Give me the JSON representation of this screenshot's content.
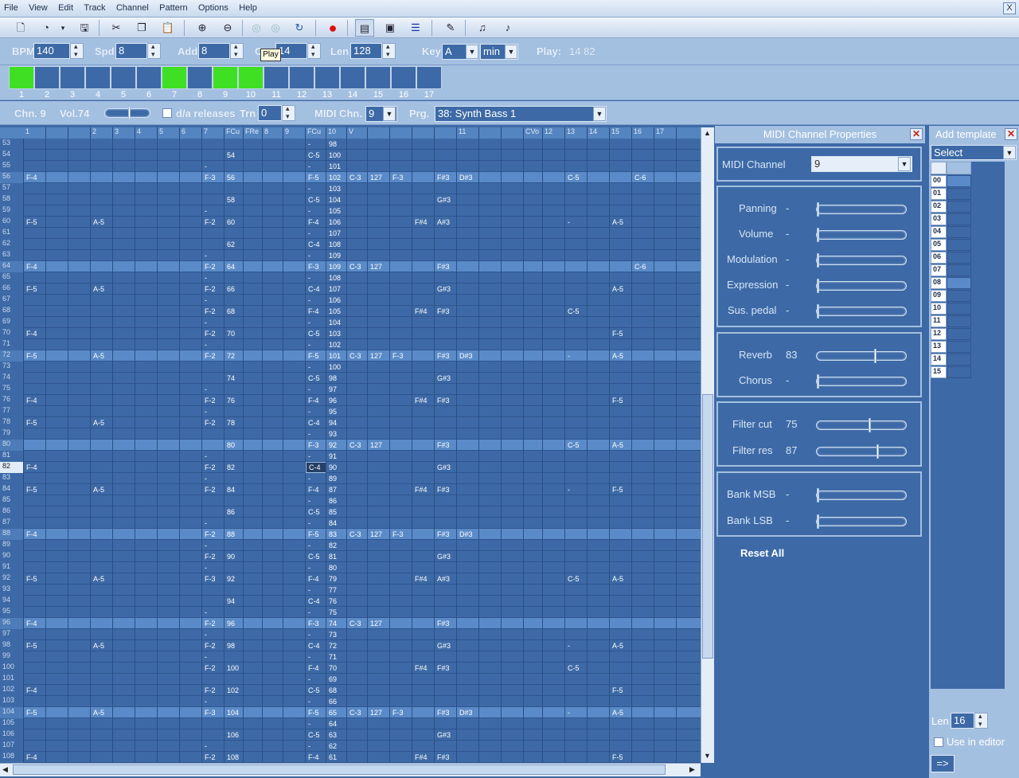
{
  "menu": [
    "File",
    "View",
    "Edit",
    "Track",
    "Channel",
    "Pattern",
    "Options",
    "Help"
  ],
  "menu_close": "X",
  "tooltip": "Play",
  "controls": {
    "bpm_label": "BPM",
    "bpm": "140",
    "spd_label": "Spd",
    "spd": "8",
    "add_label": "Add",
    "add": "8",
    "oct_label": "O",
    "oct": "14",
    "len_label": "Len",
    "len": "128",
    "key_label": "Key",
    "key": "A",
    "mode": "min",
    "play_label": "Play:",
    "play_value": "14 82"
  },
  "patterns": {
    "numbers": [
      "1",
      "2",
      "3",
      "4",
      "5",
      "6",
      "7",
      "8",
      "9",
      "10",
      "11",
      "12",
      "13",
      "14",
      "15",
      "16",
      "17"
    ],
    "active": [
      true,
      false,
      false,
      false,
      false,
      false,
      true,
      false,
      true,
      true,
      false,
      false,
      false,
      false,
      false,
      false,
      false
    ]
  },
  "channel": {
    "chn": "Chn. 9",
    "vol": "Vol.74",
    "da_releases": "d/a releases",
    "trn_label": "Trn",
    "trn": "0",
    "midi_chn_label": "MIDI Chn.",
    "midi_chn": "9",
    "prg_label": "Prg.",
    "prg": "38: Synth Bass 1"
  },
  "grid_headers": [
    "1",
    "",
    "",
    "2",
    "3",
    "4",
    "5",
    "6",
    "7",
    "FCu",
    "FRe",
    "8",
    "9",
    "FCu",
    "10",
    "V",
    "",
    "",
    "",
    "",
    "11",
    "",
    "",
    "CVo",
    "12",
    "13",
    "14",
    "15",
    "16",
    "17"
  ],
  "rows": [
    {
      "n": "53",
      "c": {
        "13": "-",
        "14": "98"
      }
    },
    {
      "n": "54",
      "c": {
        "9": "54",
        "13": "C-5",
        "14": "100"
      }
    },
    {
      "n": "55",
      "c": {
        "8": "-",
        "13": "-",
        "14": "101"
      }
    },
    {
      "n": "56",
      "c": {
        "0": "F-4",
        "8": "F-3",
        "9": "56",
        "13": "F-5",
        "14": "102",
        "15": "C-3",
        "16": "127",
        "17": "F-3",
        "19": "F#3",
        "20": "D#3",
        "25": "C-5",
        "28": "C-6"
      }
    },
    {
      "n": "57",
      "c": {
        "13": "-",
        "14": "103"
      }
    },
    {
      "n": "58",
      "c": {
        "9": "58",
        "13": "C-5",
        "14": "104",
        "19": "G#3"
      }
    },
    {
      "n": "59",
      "c": {
        "8": "-",
        "13": "-",
        "14": "105"
      }
    },
    {
      "n": "60",
      "c": {
        "0": "F-5",
        "3": "A-5",
        "8": "F-2",
        "9": "60",
        "13": "F-4",
        "14": "106",
        "18": "F#4",
        "19": "A#3",
        "25": "-",
        "27": "A-5"
      }
    },
    {
      "n": "61",
      "c": {
        "13": "-",
        "14": "107"
      }
    },
    {
      "n": "62",
      "c": {
        "9": "62",
        "13": "C-4",
        "14": "108"
      }
    },
    {
      "n": "63",
      "c": {
        "8": "-",
        "13": "-",
        "14": "109"
      }
    },
    {
      "n": "64",
      "c": {
        "0": "F-4",
        "8": "F-2",
        "9": "64",
        "13": "F-3",
        "14": "109",
        "15": "C-3",
        "16": "127",
        "19": "F#3",
        "28": "C-6"
      }
    },
    {
      "n": "65",
      "c": {
        "8": "-",
        "13": "-",
        "14": "108"
      }
    },
    {
      "n": "66",
      "c": {
        "0": "F-5",
        "3": "A-5",
        "8": "F-2",
        "9": "66",
        "13": "C-4",
        "14": "107",
        "19": "G#3",
        "27": "A-5"
      }
    },
    {
      "n": "67",
      "c": {
        "8": "-",
        "13": "-",
        "14": "106"
      }
    },
    {
      "n": "68",
      "c": {
        "8": "F-2",
        "9": "68",
        "13": "F-4",
        "14": "105",
        "18": "F#4",
        "19": "F#3",
        "25": "C-5"
      }
    },
    {
      "n": "69",
      "c": {
        "8": "-",
        "13": "-",
        "14": "104"
      }
    },
    {
      "n": "70",
      "c": {
        "0": "F-4",
        "8": "F-2",
        "9": "70",
        "13": "C-5",
        "14": "103",
        "27": "F-5"
      }
    },
    {
      "n": "71",
      "c": {
        "8": "-",
        "13": "-",
        "14": "102"
      }
    },
    {
      "n": "72",
      "c": {
        "0": "F-5",
        "3": "A-5",
        "8": "F-2",
        "9": "72",
        "13": "F-5",
        "14": "101",
        "15": "C-3",
        "16": "127",
        "17": "F-3",
        "19": "F#3",
        "20": "D#3",
        "25": "-",
        "27": "A-5"
      }
    },
    {
      "n": "73",
      "c": {
        "13": "-",
        "14": "100"
      }
    },
    {
      "n": "74",
      "c": {
        "9": "74",
        "13": "C-5",
        "14": "98",
        "19": "G#3"
      }
    },
    {
      "n": "75",
      "c": {
        "8": "-",
        "13": "-",
        "14": "97"
      }
    },
    {
      "n": "76",
      "c": {
        "0": "F-4",
        "8": "F-2",
        "9": "76",
        "13": "F-4",
        "14": "96",
        "18": "F#4",
        "19": "F#3",
        "27": "F-5"
      }
    },
    {
      "n": "77",
      "c": {
        "8": "-",
        "13": "-",
        "14": "95"
      }
    },
    {
      "n": "78",
      "c": {
        "0": "F-5",
        "3": "A-5",
        "8": "F-2",
        "9": "78",
        "13": "C-4",
        "14": "94"
      }
    },
    {
      "n": "79",
      "c": {
        "13": "-",
        "14": "93"
      }
    },
    {
      "n": "80",
      "c": {
        "9": "80",
        "13": "F-3",
        "14": "92",
        "15": "C-3",
        "16": "127",
        "19": "F#3",
        "25": "C-5",
        "27": "A-5"
      }
    },
    {
      "n": "81",
      "c": {
        "8": "-",
        "13": "-",
        "14": "91"
      }
    },
    {
      "n": "82",
      "c": {
        "0": "F-4",
        "8": "F-2",
        "9": "82",
        "13": "C-4",
        "14": "90",
        "19": "G#3"
      }
    },
    {
      "n": "83",
      "c": {
        "8": "-",
        "13": "-",
        "14": "89"
      }
    },
    {
      "n": "84",
      "c": {
        "0": "F-5",
        "3": "A-5",
        "8": "F-2",
        "9": "84",
        "13": "F-4",
        "14": "87",
        "18": "F#4",
        "19": "F#3",
        "25": "-",
        "27": "F-5"
      }
    },
    {
      "n": "85",
      "c": {
        "13": "-",
        "14": "86"
      }
    },
    {
      "n": "86",
      "c": {
        "9": "86",
        "13": "C-5",
        "14": "85"
      }
    },
    {
      "n": "87",
      "c": {
        "8": "-",
        "13": "-",
        "14": "84"
      }
    },
    {
      "n": "88",
      "c": {
        "0": "F-4",
        "8": "F-2",
        "9": "88",
        "13": "F-5",
        "14": "83",
        "15": "C-3",
        "16": "127",
        "17": "F-3",
        "19": "F#3",
        "20": "D#3"
      }
    },
    {
      "n": "89",
      "c": {
        "8": "-",
        "13": "-",
        "14": "82"
      }
    },
    {
      "n": "90",
      "c": {
        "8": "F-2",
        "9": "90",
        "13": "C-5",
        "14": "81",
        "19": "G#3"
      }
    },
    {
      "n": "91",
      "c": {
        "8": "-",
        "13": "-",
        "14": "80"
      }
    },
    {
      "n": "92",
      "c": {
        "0": "F-5",
        "3": "A-5",
        "8": "F-3",
        "9": "92",
        "13": "F-4",
        "14": "79",
        "18": "F#4",
        "19": "A#3",
        "25": "C-5",
        "27": "A-5"
      }
    },
    {
      "n": "93",
      "c": {
        "13": "-",
        "14": "77"
      }
    },
    {
      "n": "94",
      "c": {
        "9": "94",
        "13": "C-4",
        "14": "76"
      }
    },
    {
      "n": "95",
      "c": {
        "8": "-",
        "13": "-",
        "14": "75"
      }
    },
    {
      "n": "96",
      "c": {
        "0": "F-4",
        "8": "F-2",
        "9": "96",
        "13": "F-3",
        "14": "74",
        "15": "C-3",
        "16": "127",
        "19": "F#3"
      }
    },
    {
      "n": "97",
      "c": {
        "8": "-",
        "13": "-",
        "14": "73"
      }
    },
    {
      "n": "98",
      "c": {
        "0": "F-5",
        "3": "A-5",
        "8": "F-2",
        "9": "98",
        "13": "C-4",
        "14": "72",
        "19": "G#3",
        "25": "-",
        "27": "A-5"
      }
    },
    {
      "n": "99",
      "c": {
        "8": "-",
        "13": "-",
        "14": "71"
      }
    },
    {
      "n": "100",
      "c": {
        "8": "F-2",
        "9": "100",
        "13": "F-4",
        "14": "70",
        "18": "F#4",
        "19": "F#3",
        "25": "C-5"
      }
    },
    {
      "n": "101",
      "c": {
        "13": "-",
        "14": "69"
      }
    },
    {
      "n": "102",
      "c": {
        "0": "F-4",
        "8": "F-2",
        "9": "102",
        "13": "C-5",
        "14": "68",
        "27": "F-5"
      }
    },
    {
      "n": "103",
      "c": {
        "8": "-",
        "13": "-",
        "14": "66"
      }
    },
    {
      "n": "104",
      "c": {
        "0": "F-5",
        "3": "A-5",
        "8": "F-3",
        "9": "104",
        "13": "F-5",
        "14": "65",
        "15": "C-3",
        "16": "127",
        "17": "F-3",
        "19": "F#3",
        "20": "D#3",
        "25": "-",
        "27": "A-5"
      }
    },
    {
      "n": "105",
      "c": {
        "13": "-",
        "14": "64"
      }
    },
    {
      "n": "106",
      "c": {
        "9": "106",
        "13": "C-5",
        "14": "63",
        "19": "G#3"
      }
    },
    {
      "n": "107",
      "c": {
        "8": "-",
        "13": "-",
        "14": "62"
      }
    },
    {
      "n": "108",
      "c": {
        "0": "F-4",
        "8": "F-2",
        "9": "108",
        "13": "F-4",
        "14": "61",
        "18": "F#4",
        "19": "F#3",
        "27": "F-5"
      }
    }
  ],
  "midi_panel": {
    "title": "MIDI Channel Properties",
    "midi_channel_label": "MIDI Channel",
    "midi_channel": "9",
    "panning": "Panning",
    "panning_val": "-",
    "volume": "Volume",
    "volume_val": "-",
    "modulation": "Modulation",
    "modulation_val": "-",
    "expression": "Expression",
    "expression_val": "-",
    "sus_pedal": "Sus. pedal",
    "sus_pedal_val": "-",
    "reverb": "Reverb",
    "reverb_val": "83",
    "chorus": "Chorus",
    "chorus_val": "-",
    "filter_cut": "Filter cut",
    "filter_cut_val": "75",
    "filter_res": "Filter res",
    "filter_res_val": "87",
    "bank_msb": "Bank MSB",
    "bank_msb_val": "-",
    "bank_lsb": "Bank LSB",
    "bank_lsb_val": "-",
    "reset_all": "Reset All",
    "levels": {
      "panning": 0,
      "volume": 0,
      "modulation": 0,
      "expression": 0,
      "sus_pedal": 0,
      "reverb": 0.65,
      "chorus": 0,
      "filter_cut": 0.59,
      "filter_res": 0.68,
      "bank_msb": 0,
      "bank_lsb": 0
    }
  },
  "template_panel": {
    "title": "Add template",
    "select": "Select",
    "rows": [
      "00",
      "01",
      "02",
      "03",
      "04",
      "05",
      "06",
      "07",
      "08",
      "09",
      "10",
      "11",
      "12",
      "13",
      "14",
      "15"
    ],
    "len_label": "Len",
    "len": "16",
    "use_in_editor": "Use in editor",
    "apply": "=>"
  }
}
